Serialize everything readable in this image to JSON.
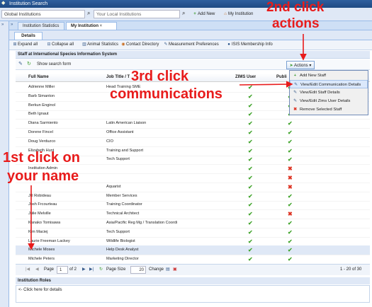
{
  "window": {
    "title": "Institution Search"
  },
  "search": {
    "institution_value": "Global Institutions",
    "local_placeholder": "Your Local Institutions",
    "add_new": "Add New",
    "my_institution": "My Institution"
  },
  "tabs": [
    "Institution Statistics",
    "My Institution"
  ],
  "subtab": "Details",
  "toolbar": [
    "Expand all",
    "Collapse all",
    "Animal Statistics",
    "Contact Directory",
    "Measurement Preferences",
    "ISIS Membership Info"
  ],
  "panel": {
    "title": "Staff at International Species Information System",
    "show_search": "Show search form",
    "actions": "Actions"
  },
  "grid": {
    "columns": [
      "Full Name",
      "Job Title / T",
      "ZIMS User",
      "Publi"
    ],
    "rows": [
      {
        "name": "Adrienne Miller",
        "title": "Head Training SME",
        "zims": "check",
        "pub": "check"
      },
      {
        "name": "Barb Simanton",
        "title": "",
        "zims": "check",
        "pub": "check"
      },
      {
        "name": "Berkun Enginol",
        "title": "",
        "zims": "check",
        "pub": "check"
      },
      {
        "name": "Beth Ignaut",
        "title": "",
        "zims": "check",
        "pub": "check"
      },
      {
        "name": "Diana Sarmiento",
        "title": "Latin American Liaison",
        "zims": "check",
        "pub": "check"
      },
      {
        "name": "Dorene Fincel",
        "title": "Office Assistant",
        "zims": "check",
        "pub": "check"
      },
      {
        "name": "Doug Verduzco",
        "title": "CIO",
        "zims": "check",
        "pub": "check"
      },
      {
        "name": "Elizabeth Hunt",
        "title": "Training and Support",
        "zims": "check",
        "pub": "check"
      },
      {
        "name": "",
        "title": "Tech Support",
        "zims": "check",
        "pub": "check"
      },
      {
        "name": "Institution Admin",
        "title": "",
        "zims": "check",
        "pub": "cross"
      },
      {
        "name": "",
        "title": "",
        "zims": "check",
        "pub": "cross"
      },
      {
        "name": "",
        "title": "Aquarist",
        "zims": "check",
        "pub": "cross"
      },
      {
        "name": "Jill Robideau",
        "title": "Member Services",
        "zims": "check",
        "pub": "check"
      },
      {
        "name": "Josh Frcourteau",
        "title": "Training Coordinator",
        "zims": "check",
        "pub": "check"
      },
      {
        "name": "Julie Melville",
        "title": "Technical Architect",
        "zims": "check",
        "pub": "cross"
      },
      {
        "name": "Kanako Tomisawa",
        "title": "Asia/Pacific Reg Mg / Translation Coordi",
        "zims": "check",
        "pub": "check"
      },
      {
        "name": "Kim Maciej",
        "title": "Tech Support",
        "zims": "check",
        "pub": "check"
      },
      {
        "name": "Laurie Freeman Lackey",
        "title": "Wildlife Biologist",
        "zims": "check",
        "pub": "check"
      },
      {
        "name": "Michele Moses",
        "title": "Help Desk Analyst",
        "zims": "check",
        "pub": "check",
        "selected": true
      },
      {
        "name": "Michele Peters",
        "title": "Marketing Director",
        "zims": "check",
        "pub": "check"
      }
    ]
  },
  "pager": {
    "page_label": "Page",
    "page_value": "1",
    "of_label": "of 2",
    "size_label": "Page Size",
    "size_value": "20",
    "change": "Change",
    "summary": "1 - 20 of 30"
  },
  "roles": {
    "title": "Institution Roles",
    "hint": "<- Click here for details"
  },
  "menu": [
    "Add New Staff",
    "View/Edit Communication Details",
    "View/Edit Staff Details",
    "View/Edit Zims User Details",
    "Remove Selected Staff"
  ],
  "annotations": {
    "second": [
      "2nd click",
      "actions"
    ],
    "third": [
      "3rd click",
      "communications"
    ],
    "first": [
      "1st click on",
      "your name"
    ]
  },
  "colors": {
    "accent": "#2f5f9e",
    "annotation": "#e81b1b",
    "check": "#44a52f",
    "cross": "#d32222"
  }
}
